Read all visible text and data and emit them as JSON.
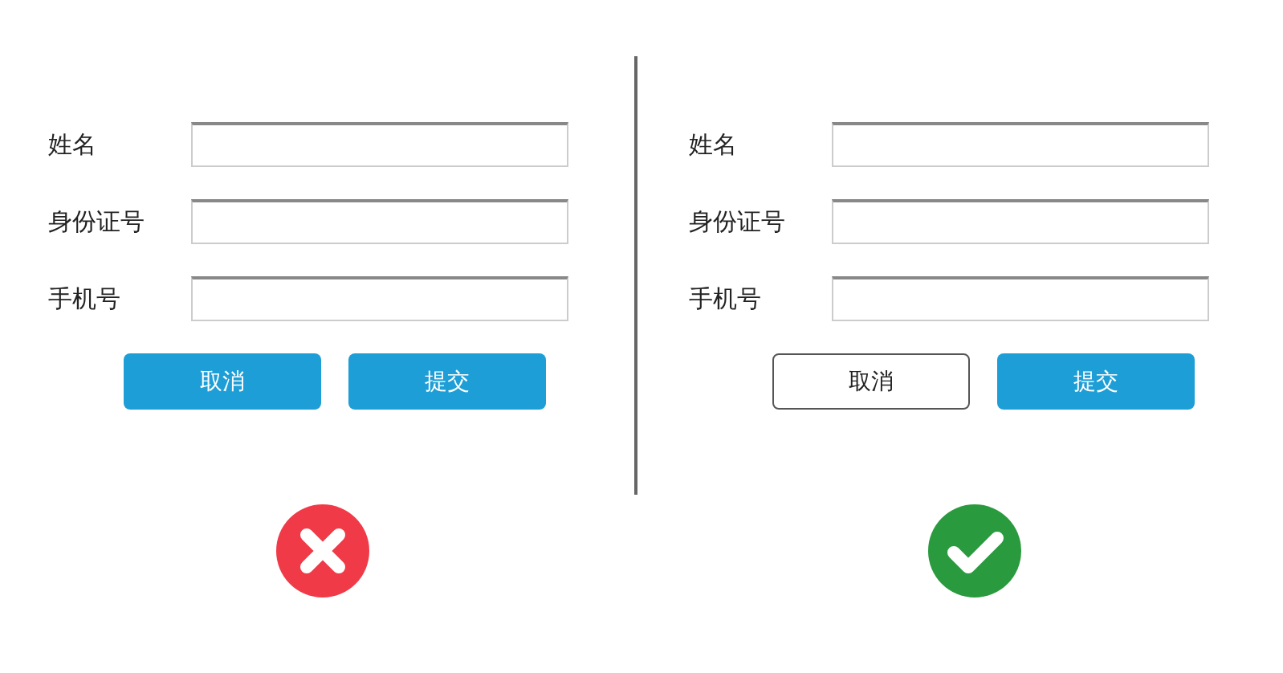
{
  "panels": [
    {
      "fields": [
        {
          "label": "姓名"
        },
        {
          "label": "身份证号"
        },
        {
          "label": "手机号"
        }
      ],
      "buttons": [
        {
          "label": "取消",
          "kind": "primary"
        },
        {
          "label": "提交",
          "kind": "primary"
        }
      ],
      "kind": "wrong"
    },
    {
      "fields": [
        {
          "label": "姓名"
        },
        {
          "label": "身份证号"
        },
        {
          "label": "手机号"
        }
      ],
      "buttons": [
        {
          "label": "取消",
          "kind": "outline"
        },
        {
          "label": "提交",
          "kind": "primary"
        }
      ],
      "kind": "right"
    }
  ]
}
